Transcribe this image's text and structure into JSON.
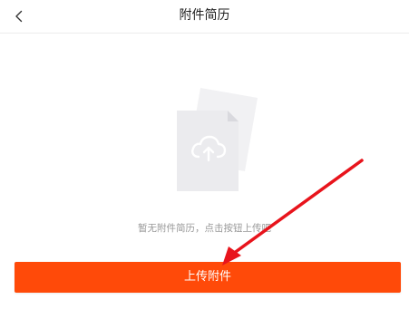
{
  "header": {
    "title": "附件简历",
    "back_icon": "chevron-left-icon"
  },
  "empty_state": {
    "illustration_icon": "cloud-upload-document-icon",
    "message": "暂无附件简历，点击按钮上传吧"
  },
  "actions": {
    "upload_label": "上传附件"
  },
  "annotation": {
    "arrow_icon": "red-arrow-icon",
    "color": "#e8141c"
  },
  "colors": {
    "accent": "#ff4a09",
    "muted_text": "#999999",
    "title_text": "#222222",
    "illustration_fill": "#f2f2f4"
  }
}
